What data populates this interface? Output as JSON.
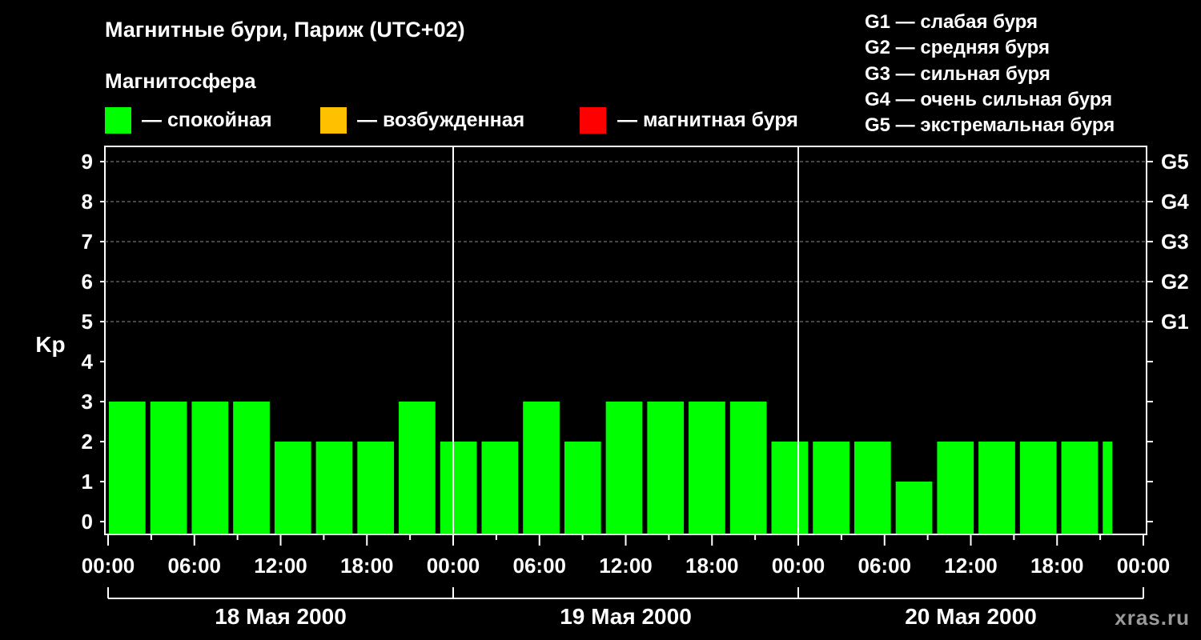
{
  "title": "Магнитные бури, Париж (UTC+02)",
  "subtitle": "Магнитосфера",
  "legend": [
    {
      "label": "— спокойная",
      "color": "#00ff00"
    },
    {
      "label": "— возбужденная",
      "color": "#ffc000"
    },
    {
      "label": "— магнитная буря",
      "color": "#ff0000"
    }
  ],
  "storm_levels": [
    "G1 — слабая буря",
    "G2 — средняя буря",
    "G3 — сильная буря",
    "G4 — очень сильная буря",
    "G5 — экстремальная буря"
  ],
  "watermark": "xras.ru",
  "chart_data": {
    "type": "bar",
    "ylabel": "Kp",
    "ylim": [
      0,
      9
    ],
    "grid": true,
    "yticks": [
      0,
      1,
      2,
      3,
      4,
      5,
      6,
      7,
      8,
      9
    ],
    "right_ticks": [
      {
        "value": 5,
        "label": "G1"
      },
      {
        "value": 6,
        "label": "G2"
      },
      {
        "value": 7,
        "label": "G3"
      },
      {
        "value": 8,
        "label": "G4"
      },
      {
        "value": 9,
        "label": "G5"
      }
    ],
    "xtick_labels": [
      "00:00",
      "06:00",
      "12:00",
      "18:00",
      "00:00",
      "06:00",
      "12:00",
      "18:00",
      "00:00",
      "06:00",
      "12:00",
      "18:00",
      "00:00"
    ],
    "days": [
      "18 Мая 2000",
      "19 Мая 2000",
      "20 Мая 2000"
    ],
    "bar_color": "#00ff00",
    "values": [
      3,
      3,
      3,
      3,
      2,
      2,
      2,
      3,
      2,
      2,
      3,
      2,
      3,
      3,
      3,
      3,
      2,
      2,
      2,
      1,
      2,
      2,
      2,
      2,
      2
    ]
  }
}
